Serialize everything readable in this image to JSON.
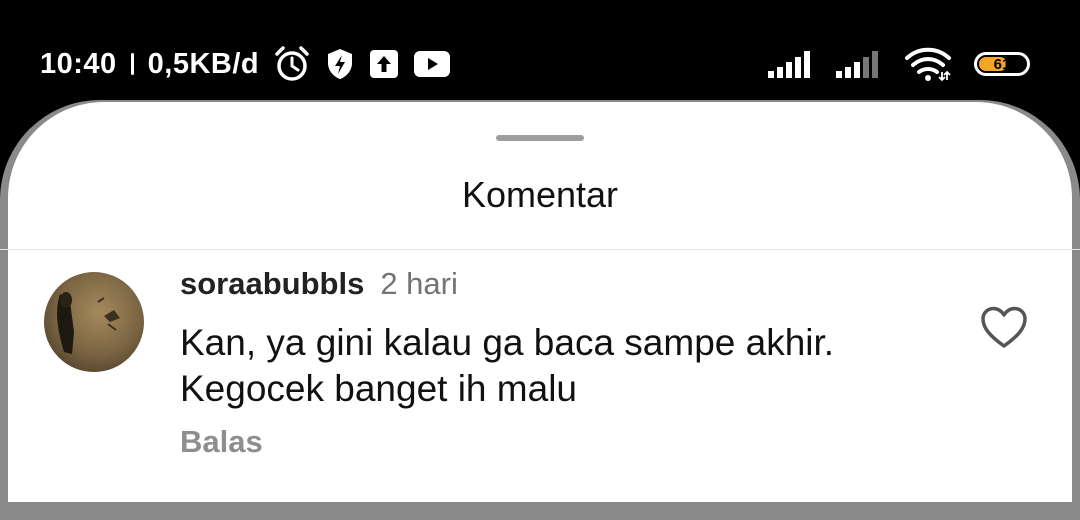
{
  "status_bar": {
    "time": "10:40",
    "network_speed": "0,5KB/d",
    "battery_level": "61",
    "icons_left": [
      "alarm-icon",
      "shield-bolt-icon",
      "upload-icon",
      "youtube-icon"
    ],
    "icons_right": [
      "signal-icon",
      "signal-icon",
      "wifi-icon",
      "battery-icon"
    ],
    "battery_color": "#f5a623"
  },
  "sheet": {
    "title": "Komentar"
  },
  "comment": {
    "username": "soraabubbls",
    "timestamp": "2 hari",
    "text_line1": "Kan, ya gini kalau ga baca sampe akhir.",
    "text_line2": "Kegocek banget ih malu",
    "reply_label": "Balas",
    "like_icon": "heart-icon"
  }
}
